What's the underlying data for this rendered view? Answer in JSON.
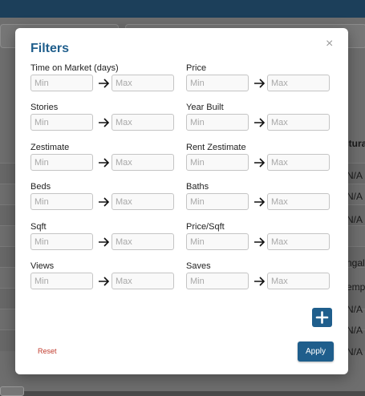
{
  "modal": {
    "title": "Filters",
    "close_icon_glyph": "×",
    "min_placeholder": "Min",
    "max_placeholder": "Max",
    "add_icon": "plus-icon",
    "reset_label": "Reset",
    "apply_label": "Apply",
    "fields": [
      {
        "label": "Time on Market (days)"
      },
      {
        "label": "Price"
      },
      {
        "label": "Stories"
      },
      {
        "label": "Year Built"
      },
      {
        "label": "Zestimate"
      },
      {
        "label": "Rent Zestimate"
      },
      {
        "label": "Beds"
      },
      {
        "label": "Baths"
      },
      {
        "label": "Sqft"
      },
      {
        "label": "Price/Sqft"
      },
      {
        "label": "Views"
      },
      {
        "label": "Saves"
      }
    ]
  },
  "background": {
    "column_header": "ctura",
    "cells": [
      "N/A",
      "N/A",
      "N/A",
      "ngal",
      "emp",
      "N/A",
      "N/A",
      "N/A"
    ]
  },
  "colors": {
    "accent": "#1f5e8c",
    "reset": "#c0392b",
    "topbar": "#1c3f5a"
  }
}
